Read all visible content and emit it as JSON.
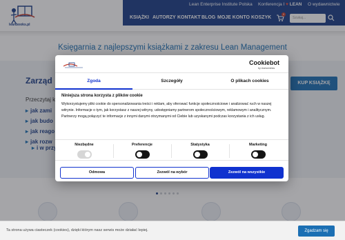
{
  "brand": {
    "logo_text": "leanbooks.pl",
    "accent": "#1b3d87",
    "link_blue": "#1b6fb3",
    "cookiebot_blue": "#1032cf"
  },
  "topbar": {
    "links": [
      "Lean Enterprise Institute Polska",
      "Konferencja I",
      "LEAN",
      "O wydawnictwie"
    ]
  },
  "nav": {
    "items": [
      "KSIĄŻKI",
      "AUTORZY",
      "KONTAKT",
      "BLOG",
      "MOJE KONTO",
      "KOSZYK"
    ],
    "cart_count": "0",
    "search_placeholder": "Szukaj..."
  },
  "page": {
    "headline": "Księgarnia z najlepszymi książkami z zakresu Lean Management",
    "hero_title": "Zarząd",
    "hero_sub": "Przeczytaj k",
    "bullets": [
      "jak zami",
      "jak budo",
      "jak reago",
      "jak rozw",
      "i w przys"
    ],
    "hero_button": "KUP KSIĄŻKĘ"
  },
  "dialog": {
    "brand": "Cookiebot",
    "brand_sub": "by Usercentrics",
    "tabs": [
      "Zgoda",
      "Szczegóły",
      "O plikach cookies"
    ],
    "active_tab": 0,
    "title": "Niniejsza strona korzysta z plików cookie",
    "text": "Wykorzystujemy pliki cookie do spersonalizowania treści i reklam, aby oferować funkcje społecznościowe i analizować ruch w naszej witrynie. Informacje o tym, jak korzystasz z naszej witryny, udostępniamy partnerom społecznościowym, reklamowym i analitycznym. Partnerzy mogą połączyć te informacje z innymi danymi otrzymanymi od Ciebie lub uzyskanymi podczas korzystania z ich usług.",
    "toggles": [
      {
        "label": "Niezbędne",
        "disabled": true
      },
      {
        "label": "Preferencje",
        "disabled": false
      },
      {
        "label": "Statystyka",
        "disabled": false
      },
      {
        "label": "Marketing",
        "disabled": false
      }
    ],
    "buttons": {
      "deny": "Odmowa",
      "allow_selection": "Zezwól na wybór",
      "allow_all": "Zezwól na wszystkie"
    }
  },
  "cookiebar": {
    "text": "Ta strona używa ciasteczek (cookies), dzięki którym nasz serwis może działać lepiej.",
    "button": "Zgadzam się"
  }
}
